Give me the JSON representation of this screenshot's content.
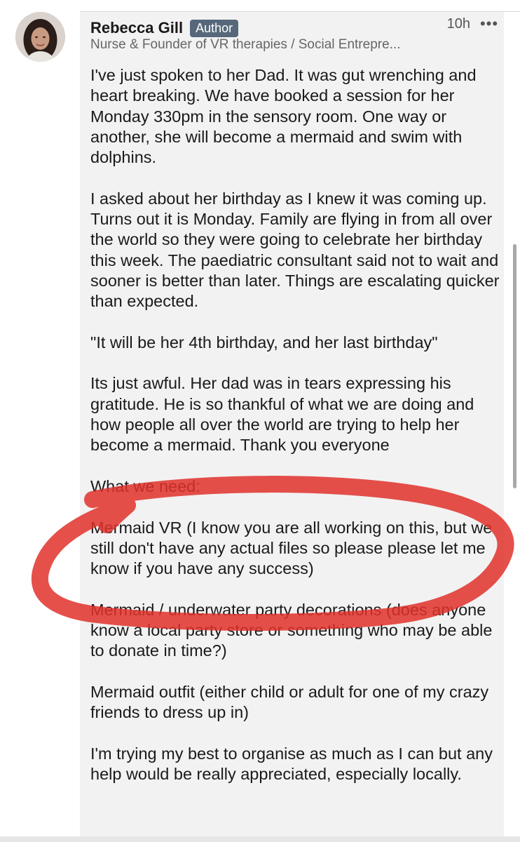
{
  "comment": {
    "author_name": "Rebecca Gill",
    "author_badge": "Author",
    "time_ago": "10h",
    "more_label": "•••",
    "headline": "Nurse & Founder of VR therapies / Social Entrepre...",
    "paragraphs": [
      "I've just spoken to her Dad. It was gut wrenching and heart breaking. We have booked a session for her Monday 330pm in the sensory room. One way or another, she will become a mermaid and swim with dolphins.",
      "I asked about her birthday as I knew it was coming up. Turns out it is Monday. Family are flying in from all over the world so they were going to celebrate her birthday this week. The paediatric consultant said not to wait and sooner is better than later. Things are escalating quicker than expected.",
      "\"It will be her 4th birthday, and her last birthday\"",
      "Its just awful. Her dad was in tears expressing his gratitude. He is so thankful of what we are doing and how people all over the world are trying to help her become a mermaid. Thank you everyone",
      "What we need:",
      "Mermaid VR (I know you are all working on this, but we still don't have any actual files so please please let me know if you have any success)",
      "Mermaid / underwater party decorations (does anyone know a local party store or something who may be able to donate in time?)",
      "Mermaid outfit (either child or adult for one of my crazy friends to dress up in)",
      "I'm trying my best to organise as much as I can but any help would be really appreciated, especially locally."
    ]
  },
  "colors": {
    "card_background": "#f2f2f2",
    "badge_background": "#56687a",
    "annotation_red": "#e0312a"
  },
  "icons": {
    "more": "more-horizontal-icon",
    "avatar": "profile-photo"
  }
}
